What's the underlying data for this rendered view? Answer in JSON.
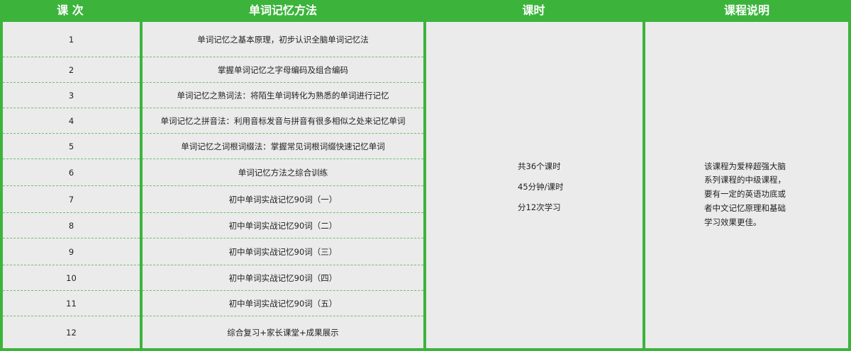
{
  "headers": [
    "课 次",
    "单词记忆方法",
    "课时",
    "课程说明"
  ],
  "rows": [
    {
      "num": "1",
      "method": "单词记忆之基本原理，初步认识全脑单词记忆法"
    },
    {
      "num": "2",
      "method": "掌握单词记忆之字母编码及组合编码"
    },
    {
      "num": "3",
      "method": "单词记忆之熟词法：将陌生单词转化为熟悉的单词进行记忆"
    },
    {
      "num": "4",
      "method": "单词记忆之拼音法：利用音标发音与拼音有很多相似之处来记忆单词"
    },
    {
      "num": "5",
      "method": "单词记忆之词根词缀法：掌握常见词根词缀快速记忆单词"
    },
    {
      "num": "6",
      "method": "单词记忆方法之综合训练"
    },
    {
      "num": "7",
      "method": "初中单词实战记忆90词（一）"
    },
    {
      "num": "8",
      "method": "初中单词实战记忆90词（二）"
    },
    {
      "num": "9",
      "method": "初中单词实战记忆90词（三）"
    },
    {
      "num": "10",
      "method": "初中单词实战记忆90词（四）"
    },
    {
      "num": "11",
      "method": "初中单词实战记忆90词（五）"
    },
    {
      "num": "12",
      "method": "综合复习+家长课堂+成果展示"
    }
  ],
  "hours": [
    "共36个课时",
    "45分钟/课时",
    "分12次学习"
  ],
  "description": [
    "该课程为爱梓超强大脑",
    "系列课程的中级课程，",
    "要有一定的英语功底或",
    "者中文记忆原理和基础",
    "学习效果更佳。"
  ],
  "colors": {
    "green": "#3cb43c",
    "cell": "#ebebeb",
    "dash": "#6fbf6f"
  }
}
